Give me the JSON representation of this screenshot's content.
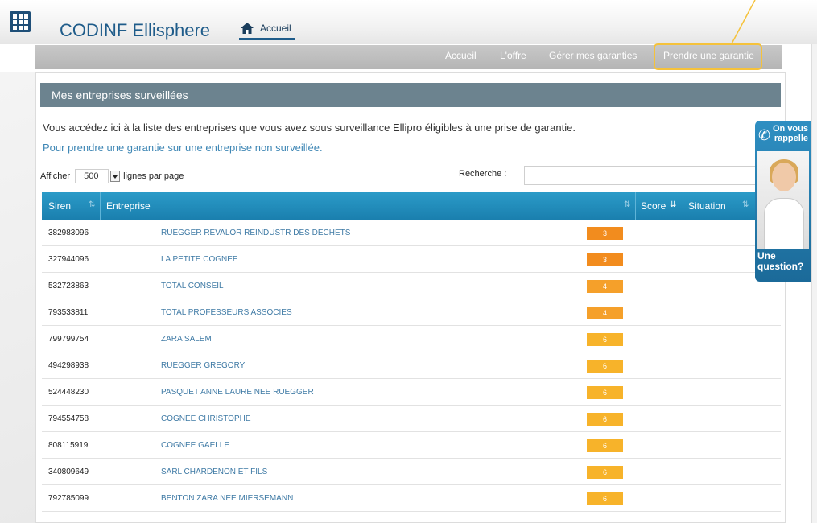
{
  "header": {
    "app_title": "CODINF Ellisphere",
    "home_tab": "Accueil"
  },
  "nav": {
    "items": [
      "Accueil",
      "L'offre",
      "Gérer mes garanties",
      "Prendre une garantie"
    ]
  },
  "panel": {
    "title": "Mes entreprises surveillées",
    "intro": "Vous accédez ici à la liste des entreprises que vous avez sous surveillance Ellipro éligibles à une prise de garantie.",
    "link": "Pour prendre une garantie sur une entreprise non surveillée."
  },
  "controls": {
    "show_label": "Afficher",
    "page_size": "500",
    "per_page_label": "lignes par page",
    "search_label": "Recherche :",
    "search_value": ""
  },
  "table": {
    "headers": [
      "Siren",
      "Entreprise",
      "Score",
      "Situation"
    ],
    "rows": [
      {
        "siren": "382983096",
        "company": "RUEGGER REVALOR REINDUSTR DES DECHETS",
        "score": "3"
      },
      {
        "siren": "327944096",
        "company": "LA PETITE COGNEE",
        "score": "3"
      },
      {
        "siren": "532723863",
        "company": "TOTAL CONSEIL",
        "score": "4"
      },
      {
        "siren": "793533811",
        "company": "TOTAL PROFESSEURS ASSOCIES",
        "score": "4"
      },
      {
        "siren": "799799754",
        "company": "ZARA SALEM",
        "score": "6"
      },
      {
        "siren": "494298938",
        "company": "RUEGGER GREGORY",
        "score": "6"
      },
      {
        "siren": "524448230",
        "company": "PASQUET ANNE LAURE NEE RUEGGER",
        "score": "6"
      },
      {
        "siren": "794554758",
        "company": "COGNEE CHRISTOPHE",
        "score": "6"
      },
      {
        "siren": "808115919",
        "company": "COGNEE GAELLE",
        "score": "6"
      },
      {
        "siren": "340809649",
        "company": "SARL CHARDENON ET FILS",
        "score": "6"
      },
      {
        "siren": "792785099",
        "company": "BENTON ZARA NEE MIERSEMANN",
        "score": "6"
      }
    ]
  },
  "widget": {
    "top_line1": "On vous",
    "top_line2": "rappelle",
    "bottom_line1": "Une",
    "bottom_line2": "question?"
  },
  "colors": {
    "score_3": "#f28c1e",
    "score_4": "#f5a02a",
    "score_6": "#f7b32a",
    "accent": "#1f5c8a",
    "highlight": "#f5c23b"
  }
}
